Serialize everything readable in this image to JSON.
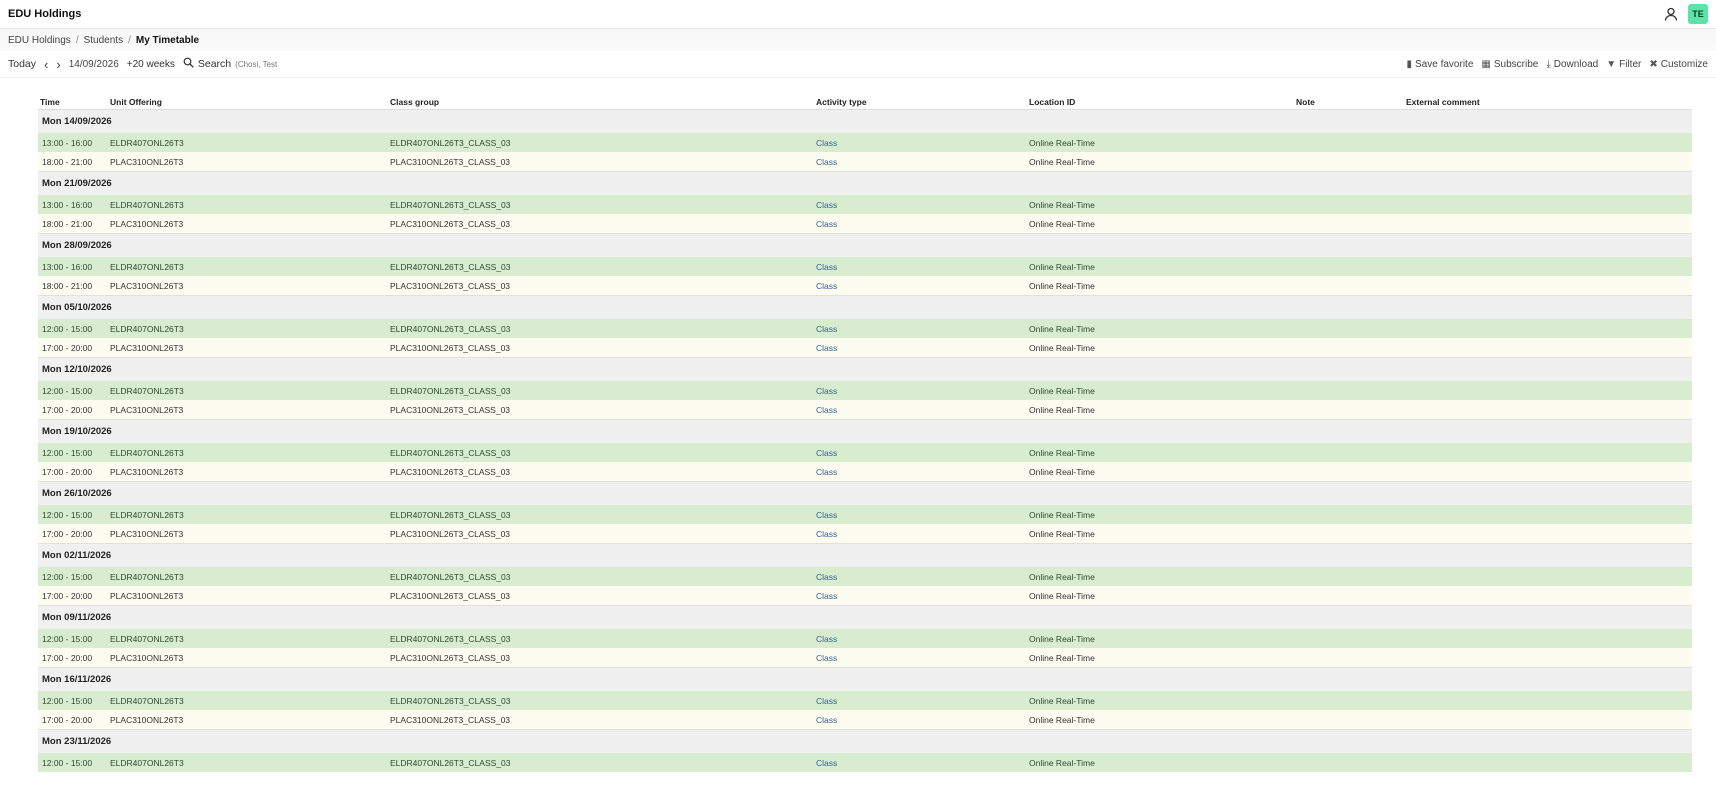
{
  "app": {
    "title": "EDU Holdings",
    "avatar_initials": "TE"
  },
  "breadcrumb": {
    "items": [
      "EDU Holdings",
      "Students"
    ],
    "current": "My Timetable",
    "separator": "/"
  },
  "toolbar": {
    "today": "Today",
    "prev": "‹",
    "next": "›",
    "date": "14/09/2026",
    "weeks": "+20 weeks",
    "search_label": "Search",
    "search_placeholder": "(Chosi, Test",
    "save_favorite": "Save favorite",
    "subscribe": "Subscribe",
    "download": "Download",
    "filter": "Filter",
    "customize": "Customize"
  },
  "table": {
    "headers": {
      "time": "Time",
      "unit": "Unit Offering",
      "class_group": "Class group",
      "activity": "Activity type",
      "location": "Location ID",
      "note": "Note",
      "external": "External comment"
    },
    "groups": [
      {
        "date": "Mon 14/09/2026",
        "rows": [
          {
            "time": "13:00 - 16:00",
            "unit": "ELDR407ONL26T3",
            "group": "ELDR407ONL26T3_CLASS_03",
            "activity": "Class",
            "location": "Online Real-Time"
          },
          {
            "time": "18:00 - 21:00",
            "unit": "PLAC310ONL26T3",
            "group": "PLAC310ONL26T3_CLASS_03",
            "activity": "Class",
            "location": "Online Real-Time"
          }
        ]
      },
      {
        "date": "Mon 21/09/2026",
        "rows": [
          {
            "time": "13:00 - 16:00",
            "unit": "ELDR407ONL26T3",
            "group": "ELDR407ONL26T3_CLASS_03",
            "activity": "Class",
            "location": "Online Real-Time"
          },
          {
            "time": "18:00 - 21:00",
            "unit": "PLAC310ONL26T3",
            "group": "PLAC310ONL26T3_CLASS_03",
            "activity": "Class",
            "location": "Online Real-Time"
          }
        ]
      },
      {
        "date": "Mon 28/09/2026",
        "rows": [
          {
            "time": "13:00 - 16:00",
            "unit": "ELDR407ONL26T3",
            "group": "ELDR407ONL26T3_CLASS_03",
            "activity": "Class",
            "location": "Online Real-Time"
          },
          {
            "time": "18:00 - 21:00",
            "unit": "PLAC310ONL26T3",
            "group": "PLAC310ONL26T3_CLASS_03",
            "activity": "Class",
            "location": "Online Real-Time"
          }
        ]
      },
      {
        "date": "Mon 05/10/2026",
        "rows": [
          {
            "time": "12:00 - 15:00",
            "unit": "ELDR407ONL26T3",
            "group": "ELDR407ONL26T3_CLASS_03",
            "activity": "Class",
            "location": "Online Real-Time"
          },
          {
            "time": "17:00 - 20:00",
            "unit": "PLAC310ONL26T3",
            "group": "PLAC310ONL26T3_CLASS_03",
            "activity": "Class",
            "location": "Online Real-Time"
          }
        ]
      },
      {
        "date": "Mon 12/10/2026",
        "rows": [
          {
            "time": "12:00 - 15:00",
            "unit": "ELDR407ONL26T3",
            "group": "ELDR407ONL26T3_CLASS_03",
            "activity": "Class",
            "location": "Online Real-Time"
          },
          {
            "time": "17:00 - 20:00",
            "unit": "PLAC310ONL26T3",
            "group": "PLAC310ONL26T3_CLASS_03",
            "activity": "Class",
            "location": "Online Real-Time"
          }
        ]
      },
      {
        "date": "Mon 19/10/2026",
        "rows": [
          {
            "time": "12:00 - 15:00",
            "unit": "ELDR407ONL26T3",
            "group": "ELDR407ONL26T3_CLASS_03",
            "activity": "Class",
            "location": "Online Real-Time"
          },
          {
            "time": "17:00 - 20:00",
            "unit": "PLAC310ONL26T3",
            "group": "PLAC310ONL26T3_CLASS_03",
            "activity": "Class",
            "location": "Online Real-Time"
          }
        ]
      },
      {
        "date": "Mon 26/10/2026",
        "rows": [
          {
            "time": "12:00 - 15:00",
            "unit": "ELDR407ONL26T3",
            "group": "ELDR407ONL26T3_CLASS_03",
            "activity": "Class",
            "location": "Online Real-Time"
          },
          {
            "time": "17:00 - 20:00",
            "unit": "PLAC310ONL26T3",
            "group": "PLAC310ONL26T3_CLASS_03",
            "activity": "Class",
            "location": "Online Real-Time"
          }
        ]
      },
      {
        "date": "Mon 02/11/2026",
        "rows": [
          {
            "time": "12:00 - 15:00",
            "unit": "ELDR407ONL26T3",
            "group": "ELDR407ONL26T3_CLASS_03",
            "activity": "Class",
            "location": "Online Real-Time"
          },
          {
            "time": "17:00 - 20:00",
            "unit": "PLAC310ONL26T3",
            "group": "PLAC310ONL26T3_CLASS_03",
            "activity": "Class",
            "location": "Online Real-Time"
          }
        ]
      },
      {
        "date": "Mon 09/11/2026",
        "rows": [
          {
            "time": "12:00 - 15:00",
            "unit": "ELDR407ONL26T3",
            "group": "ELDR407ONL26T3_CLASS_03",
            "activity": "Class",
            "location": "Online Real-Time"
          },
          {
            "time": "17:00 - 20:00",
            "unit": "PLAC310ONL26T3",
            "group": "PLAC310ONL26T3_CLASS_03",
            "activity": "Class",
            "location": "Online Real-Time"
          }
        ]
      },
      {
        "date": "Mon 16/11/2026",
        "rows": [
          {
            "time": "12:00 - 15:00",
            "unit": "ELDR407ONL26T3",
            "group": "ELDR407ONL26T3_CLASS_03",
            "activity": "Class",
            "location": "Online Real-Time"
          },
          {
            "time": "17:00 - 20:00",
            "unit": "PLAC310ONL26T3",
            "group": "PLAC310ONL26T3_CLASS_03",
            "activity": "Class",
            "location": "Online Real-Time"
          }
        ]
      },
      {
        "date": "Mon 23/11/2026",
        "rows": [
          {
            "time": "12:00 - 15:00",
            "unit": "ELDR407ONL26T3",
            "group": "ELDR407ONL26T3_CLASS_03",
            "activity": "Class",
            "location": "Online Real-Time"
          }
        ]
      }
    ]
  },
  "colors": {
    "row_a": "#d8edd0",
    "row_b": "#fcfcf0",
    "group": "#f0f0f0",
    "avatar": "#5be3a8"
  }
}
